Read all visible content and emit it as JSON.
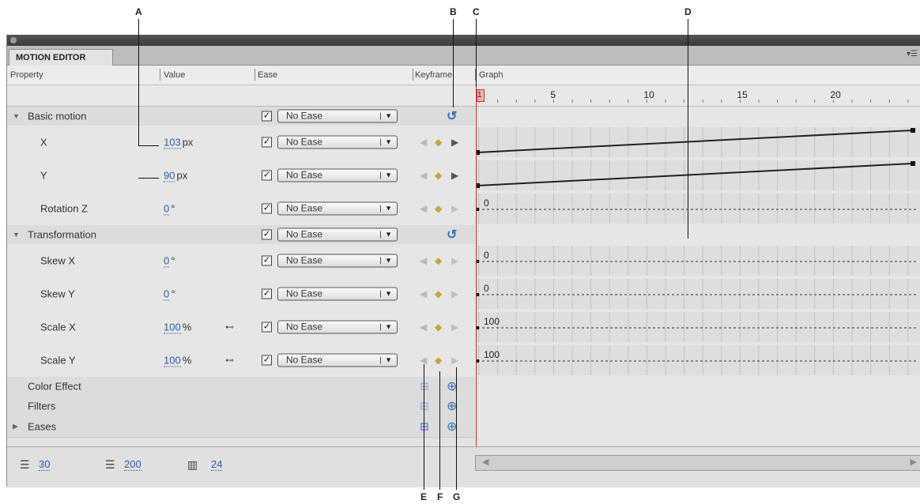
{
  "callouts": {
    "a": "A",
    "b": "B",
    "c": "C",
    "d": "D",
    "e": "E",
    "f": "F",
    "g": "G"
  },
  "panel": {
    "tab": "MOTION EDITOR"
  },
  "columns": {
    "property": "Property",
    "value": "Value",
    "ease": "Ease",
    "keyframe": "Keyframe",
    "graph": "Graph"
  },
  "ruler": {
    "playhead_frame": "1",
    "ticks": [
      "5",
      "10",
      "15",
      "20"
    ]
  },
  "rows": [
    {
      "type": "group",
      "label": "Basic motion",
      "expanded": true,
      "ease_checked": true,
      "ease": "No Ease",
      "button": "reset-icon"
    },
    {
      "type": "prop",
      "label": "X",
      "value": "103",
      "unit": "px",
      "ease_checked": true,
      "ease": "No Ease",
      "next_keyframe": true,
      "graph": "line"
    },
    {
      "type": "prop",
      "label": "Y",
      "value": "90",
      "unit": "px",
      "ease_checked": true,
      "ease": "No Ease",
      "next_keyframe": true,
      "graph": "line"
    },
    {
      "type": "prop",
      "label": "Rotation Z",
      "value": "0",
      "unit": "°",
      "ease_checked": true,
      "ease": "No Ease",
      "graph_label": "0"
    },
    {
      "type": "group",
      "label": "Transformation",
      "expanded": true,
      "ease_checked": true,
      "ease": "No Ease",
      "button": "reset-icon"
    },
    {
      "type": "prop",
      "label": "Skew X",
      "value": "0",
      "unit": "°",
      "ease_checked": true,
      "ease": "No Ease",
      "graph_label": "0"
    },
    {
      "type": "prop",
      "label": "Skew Y",
      "value": "0",
      "unit": "°",
      "ease_checked": true,
      "ease": "No Ease",
      "graph_label": "0"
    },
    {
      "type": "prop",
      "label": "Scale X",
      "value": "100",
      "unit": "%",
      "linked": true,
      "ease_checked": true,
      "ease": "No Ease",
      "graph_label": "100"
    },
    {
      "type": "prop",
      "label": "Scale Y",
      "value": "100",
      "unit": "%",
      "linked": true,
      "ease_checked": true,
      "ease": "No Ease",
      "graph_label": "100"
    },
    {
      "type": "section",
      "label": "Color Effect"
    },
    {
      "type": "section",
      "label": "Filters"
    },
    {
      "type": "section",
      "label": "Eases",
      "collapsed": true
    }
  ],
  "footer": {
    "graph_size": "30",
    "expanded_graph_size": "200",
    "viewable_frames": "24"
  }
}
